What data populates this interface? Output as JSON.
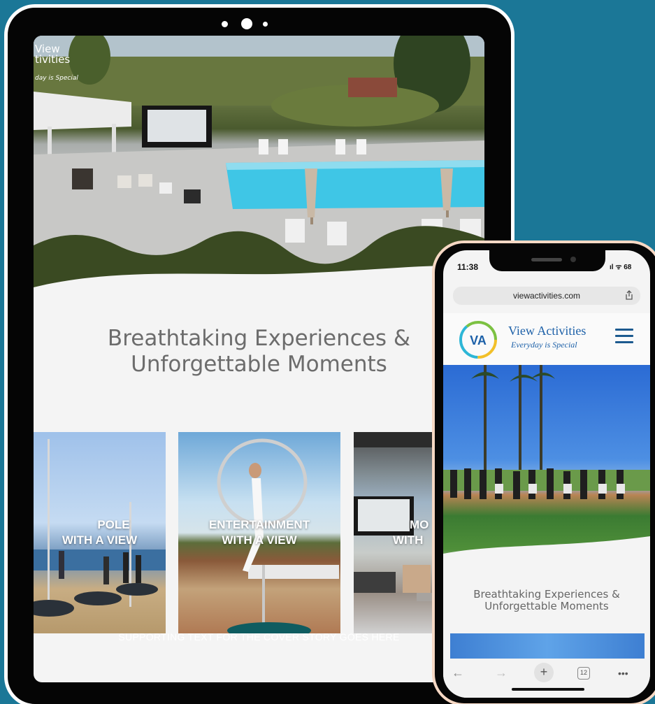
{
  "tablet": {
    "logo_title_lines": [
      "View",
      "tivities"
    ],
    "logo_tagline": "day is Special",
    "headline_lines": [
      "Breathtaking Experiences &",
      "Unforgettable Moments"
    ],
    "cards": [
      {
        "label_lines": [
          "POLE",
          "WITH A VIEW"
        ]
      },
      {
        "label_lines": [
          "ENTERTAINMENT",
          "WITH A VIEW"
        ]
      },
      {
        "label_lines": [
          "MO",
          "WITH"
        ]
      }
    ],
    "supporting_text": "SUPPORTING TEXT FOR THE COVER STORY GOES HERE"
  },
  "phone": {
    "status_time": "11:38",
    "status_icons": "ıl ᯤ 68",
    "url": "viewactivities.com",
    "brand_name": "View Activities",
    "brand_tagline": "Everyday is Special",
    "logo_text": "VA",
    "headline_lines": [
      "Breathtaking Experiences &",
      "Unforgettable Moments"
    ],
    "tab_count": "12"
  },
  "colors": {
    "background": "#1b7797",
    "brand_blue": "#1c60a8",
    "phone_frame": "#f6d8c4"
  }
}
